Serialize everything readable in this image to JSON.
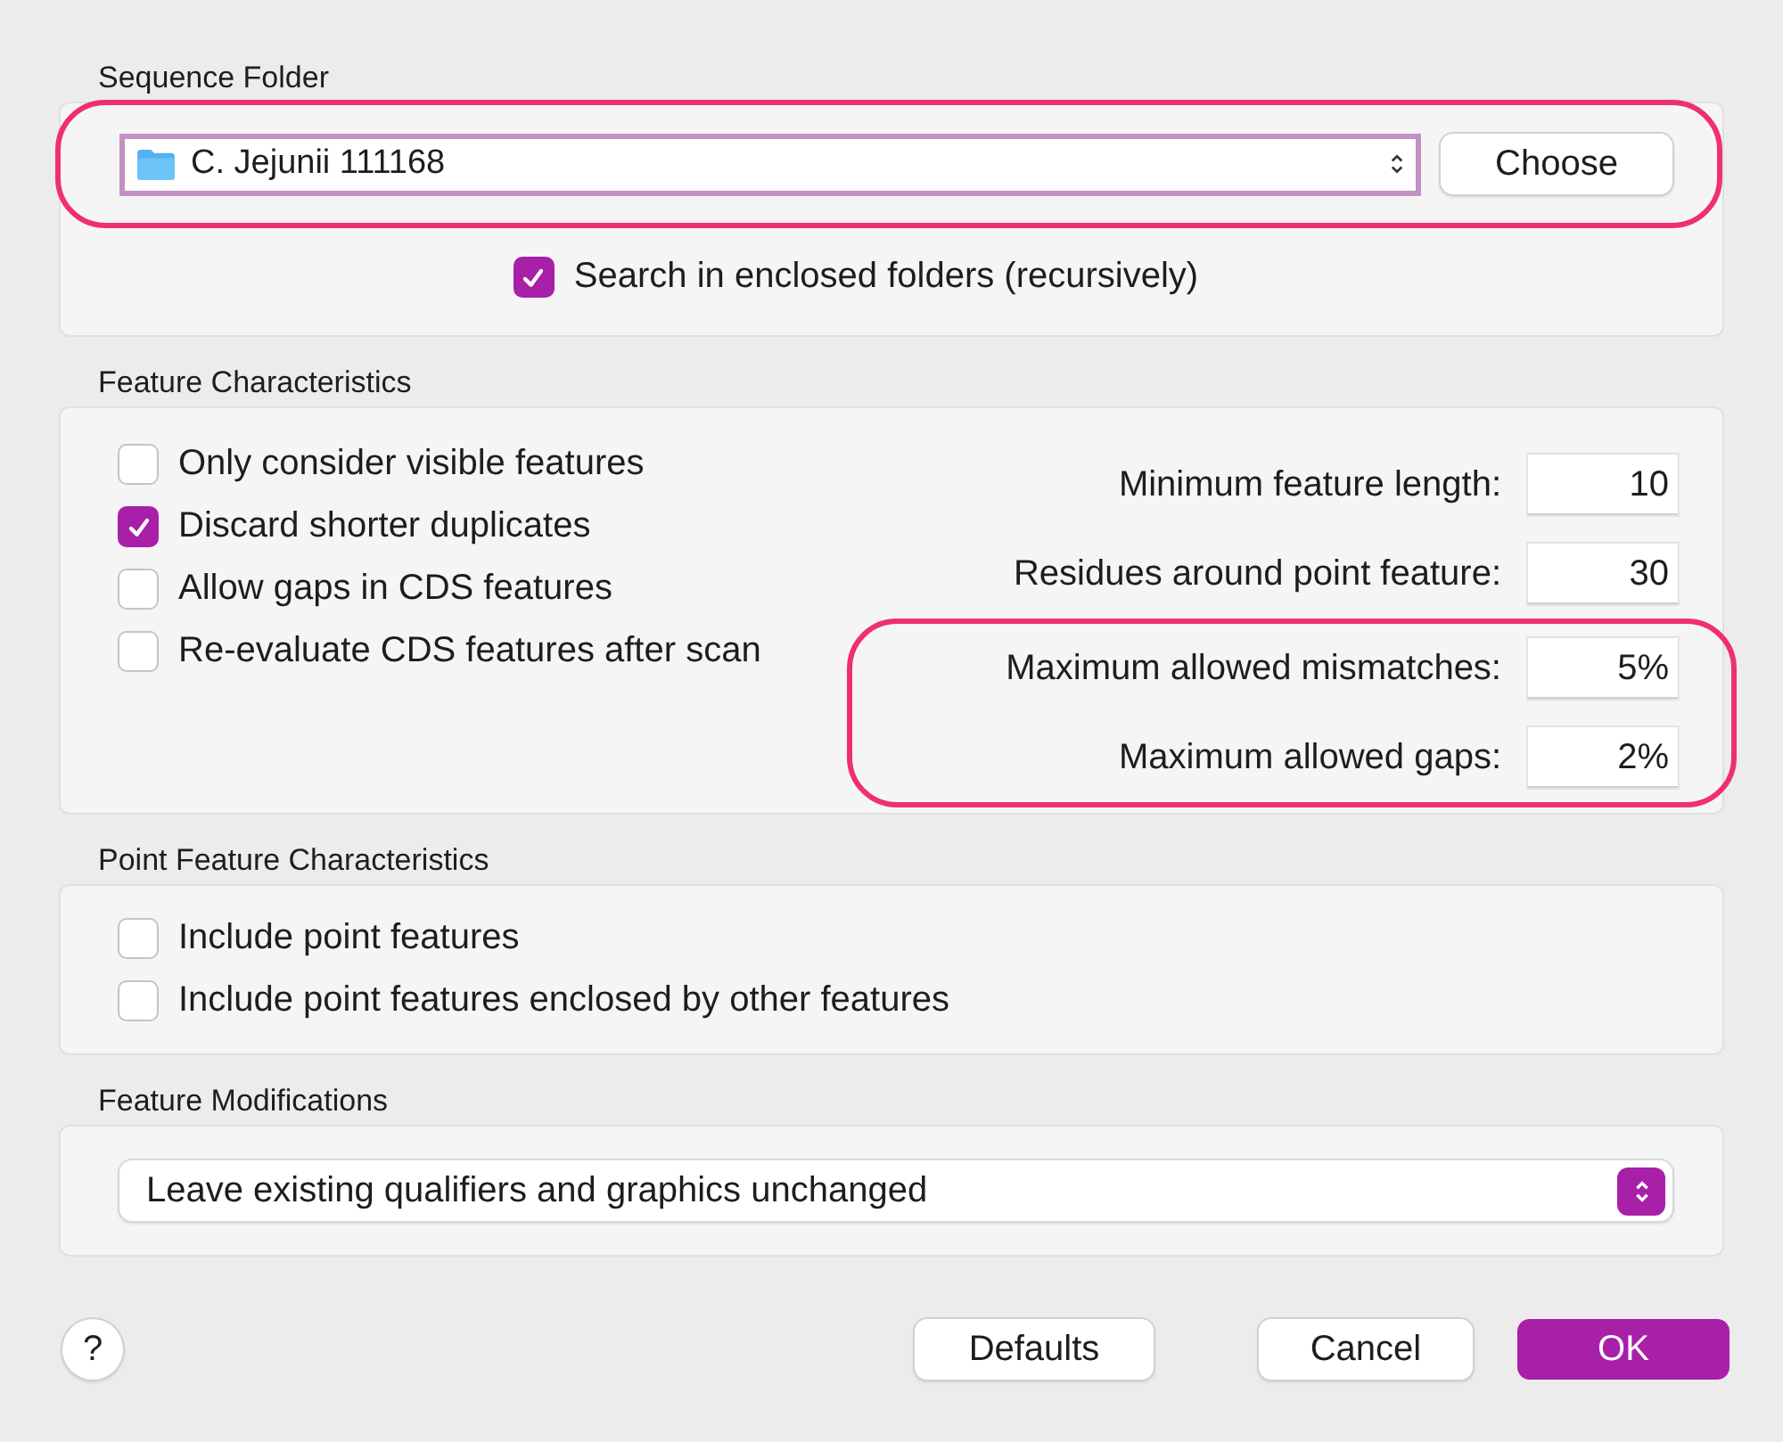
{
  "sequence_folder": {
    "label": "Sequence Folder",
    "highlighted": true,
    "folder": {
      "value": "C. Jejunii 111168",
      "focused": true
    },
    "choose_button": "Choose",
    "recursive": {
      "label": "Search in enclosed folders (recursively)",
      "checked": true
    }
  },
  "feature_characteristics": {
    "label": "Feature Characteristics",
    "options": [
      {
        "label": "Only consider visible features",
        "checked": false
      },
      {
        "label": "Discard shorter duplicates",
        "checked": true
      },
      {
        "label": "Allow gaps in CDS features",
        "checked": false
      },
      {
        "label": "Re-evaluate CDS features after scan",
        "checked": false
      }
    ],
    "parameters": [
      {
        "label": "Minimum feature length:",
        "value": "10",
        "highlighted": false
      },
      {
        "label": "Residues around point feature:",
        "value": "30",
        "highlighted": false
      },
      {
        "label": "Maximum allowed mismatches:",
        "value": "5%",
        "highlighted": true
      },
      {
        "label": "Maximum allowed gaps:",
        "value": "2%",
        "highlighted": true
      }
    ]
  },
  "point_feature_characteristics": {
    "label": "Point Feature Characteristics",
    "options": [
      {
        "label": "Include point features",
        "checked": false
      },
      {
        "label": "Include point features enclosed by other features",
        "checked": false
      }
    ]
  },
  "feature_modifications": {
    "label": "Feature Modifications",
    "value": "Leave existing qualifiers and graphics unchanged"
  },
  "buttons": {
    "help": "?",
    "defaults": "Defaults",
    "cancel": "Cancel",
    "ok": "OK"
  }
}
